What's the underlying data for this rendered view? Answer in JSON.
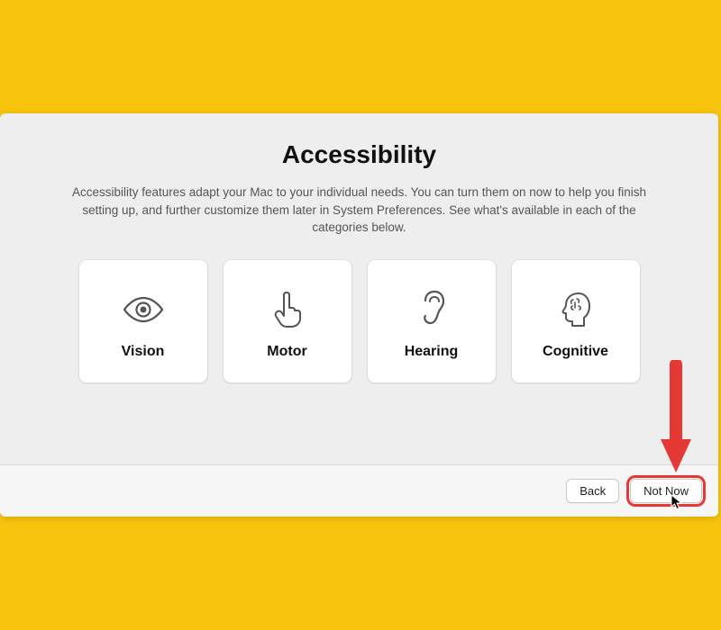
{
  "title": "Accessibility",
  "subtitle": "Accessibility features adapt your Mac to your individual needs. You can turn them on now to help you finish setting up, and further customize them later in System Preferences. See what's available in each of the categories below.",
  "cards": [
    {
      "label": "Vision"
    },
    {
      "label": "Motor"
    },
    {
      "label": "Hearing"
    },
    {
      "label": "Cognitive"
    }
  ],
  "footer": {
    "back_label": "Back",
    "notnow_label": "Not Now"
  },
  "annotation": {
    "arrow_color": "#e53935",
    "highlight_color": "#e53935"
  }
}
